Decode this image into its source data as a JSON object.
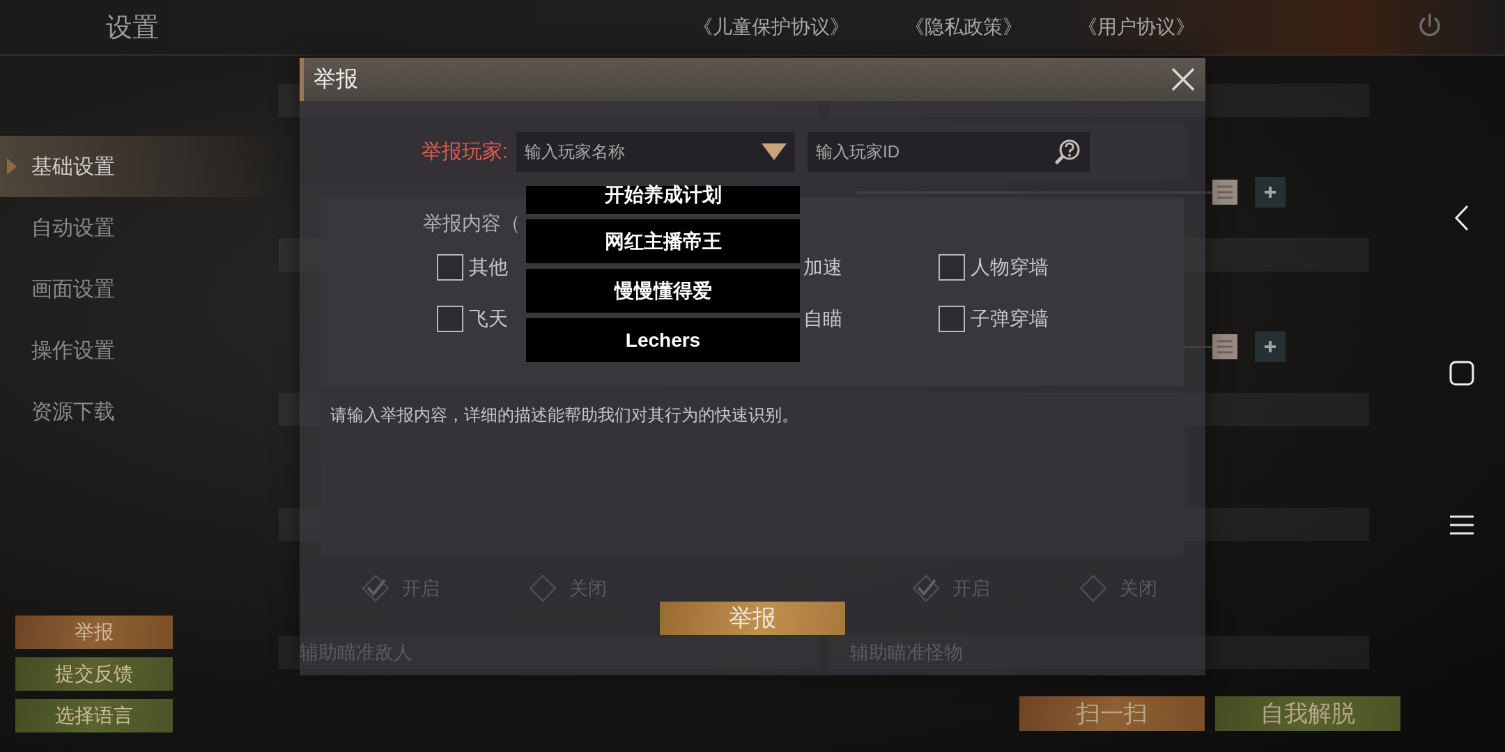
{
  "header": {
    "title": "设置",
    "links": [
      "《儿童保护协议》",
      "《隐私政策》",
      "《用户协议》"
    ]
  },
  "sidebar": {
    "items": [
      {
        "label": "基础设置",
        "selected": true
      },
      {
        "label": "自动设置",
        "selected": false
      },
      {
        "label": "画面设置",
        "selected": false
      },
      {
        "label": "操作设置",
        "selected": false
      },
      {
        "label": "资源下载",
        "selected": false
      }
    ],
    "buttons": [
      {
        "label": "举报",
        "kind": "orange"
      },
      {
        "label": "提交反馈",
        "kind": "olive"
      },
      {
        "label": "选择语言",
        "kind": "olive"
      }
    ]
  },
  "settings": {
    "columns": [
      {
        "rows": [
          {
            "kind": "bar"
          },
          {
            "kind": "spacer"
          },
          {
            "kind": "bar"
          },
          {
            "kind": "spacer"
          },
          {
            "kind": "bar"
          },
          {
            "kind": "gap"
          },
          {
            "kind": "bar"
          },
          {
            "kind": "radios",
            "options": [
              {
                "label": "开启",
                "selected": true
              },
              {
                "label": "关闭",
                "selected": false
              }
            ]
          },
          {
            "kind": "bar",
            "label": "辅助瞄准敌人"
          }
        ]
      },
      {
        "rows": [
          {
            "kind": "bar"
          },
          {
            "kind": "slider",
            "level": 1
          },
          {
            "kind": "bar"
          },
          {
            "kind": "slider",
            "level": 1
          },
          {
            "kind": "bar"
          },
          {
            "kind": "gap"
          },
          {
            "kind": "bar"
          },
          {
            "kind": "radios",
            "options": [
              {
                "label": "开启",
                "selected": true
              },
              {
                "label": "关闭",
                "selected": false
              }
            ]
          },
          {
            "kind": "bar",
            "label": "辅助瞄准怪物"
          }
        ]
      }
    ]
  },
  "actions": [
    {
      "label": "扫一扫",
      "kind": "orange"
    },
    {
      "label": "自我解脱",
      "kind": "olive"
    }
  ],
  "report_dialog": {
    "title": "举报",
    "player_label": "举报玩家:",
    "name_field": {
      "placeholder": "输入玩家名称"
    },
    "id_field": {
      "placeholder": "输入玩家ID"
    },
    "content_title": "举报内容（",
    "options": [
      {
        "label": "其他",
        "kind": "checkbox",
        "checked": false
      },
      {
        "label": "加速",
        "kind": "covered"
      },
      {
        "label": "人物穿墙",
        "kind": "checkbox",
        "checked": false
      },
      {
        "label": "飞天",
        "kind": "checkbox",
        "checked": false
      },
      {
        "label": "自瞄",
        "kind": "covered"
      },
      {
        "label": "子弹穿墙",
        "kind": "checkbox",
        "checked": false
      }
    ],
    "dropdown": {
      "items": [
        "开始养成计划",
        "网红主播帝王",
        "慢慢懂得爱",
        "Lechers"
      ]
    },
    "description": {
      "placeholder": "请输入举报内容，详细的描述能帮助我们对其行为的快速识别。"
    },
    "submit": "举报"
  }
}
